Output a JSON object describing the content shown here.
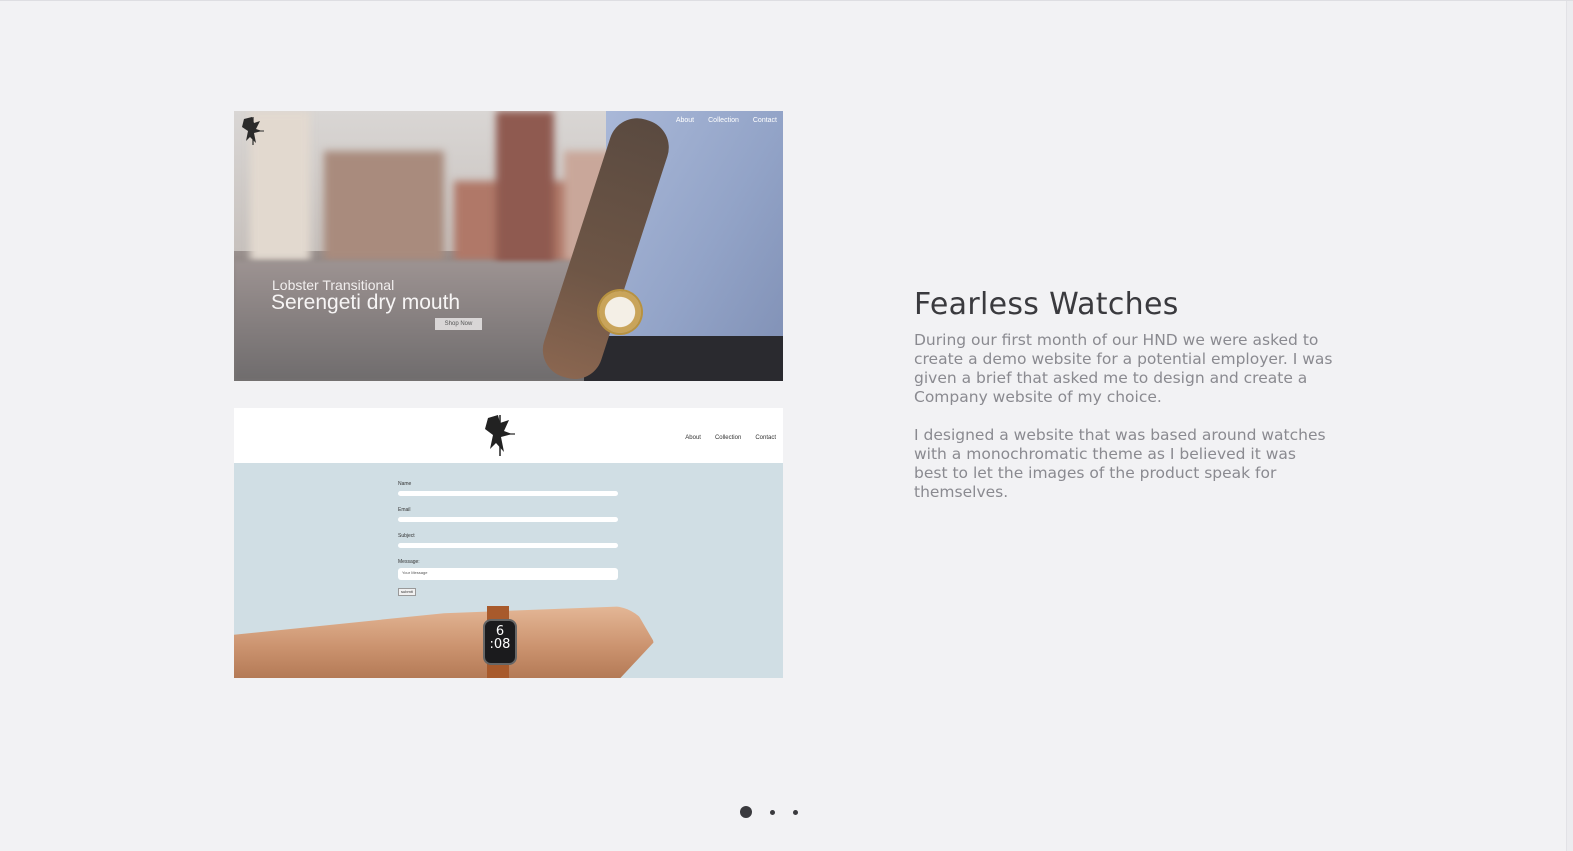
{
  "project": {
    "title": "Fearless Watches",
    "paragraphs": [
      "During our first month of our HND we were asked to create a demo website for a potential employer. I was given a brief that asked me to design and create a Company website of my choice.",
      "I designed a website that was based around watches with a monochromatic theme as I believed it was best to let the images of the product speak for themselves."
    ]
  },
  "screenshot_hero": {
    "nav": [
      "About",
      "Collection",
      "Contact"
    ],
    "subtitle": "Lobster Transitional",
    "title": "Serengeti dry mouth",
    "button": "Shop Now"
  },
  "screenshot_contact": {
    "nav": [
      "About",
      "Collection",
      "Contact"
    ],
    "fields": [
      "Name",
      "Email",
      "Subject",
      "Message:"
    ],
    "message_placeholder": "Your Message",
    "submit": "submit",
    "watch_time_top": "6",
    "watch_time_bottom": ":08"
  },
  "pager": {
    "count": 3,
    "active_index": 0
  },
  "colors": {
    "background": "#f2f2f4",
    "title": "#3a3a3e",
    "body_text": "#8a8a90",
    "dot": "#3a3a3e"
  }
}
